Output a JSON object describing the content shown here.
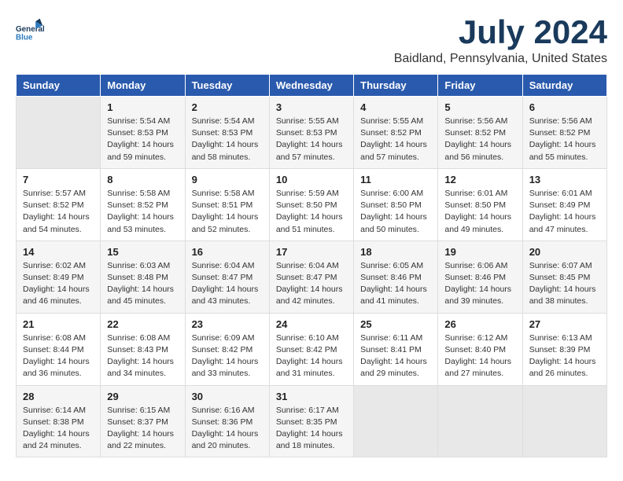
{
  "header": {
    "logo_line1": "General",
    "logo_line2": "Blue",
    "title": "July 2024",
    "subtitle": "Baidland, Pennsylvania, United States"
  },
  "days_of_week": [
    "Sunday",
    "Monday",
    "Tuesday",
    "Wednesday",
    "Thursday",
    "Friday",
    "Saturday"
  ],
  "weeks": [
    [
      {
        "date": "",
        "content": ""
      },
      {
        "date": "1",
        "content": "Sunrise: 5:54 AM\nSunset: 8:53 PM\nDaylight: 14 hours\nand 59 minutes."
      },
      {
        "date": "2",
        "content": "Sunrise: 5:54 AM\nSunset: 8:53 PM\nDaylight: 14 hours\nand 58 minutes."
      },
      {
        "date": "3",
        "content": "Sunrise: 5:55 AM\nSunset: 8:53 PM\nDaylight: 14 hours\nand 57 minutes."
      },
      {
        "date": "4",
        "content": "Sunrise: 5:55 AM\nSunset: 8:52 PM\nDaylight: 14 hours\nand 57 minutes."
      },
      {
        "date": "5",
        "content": "Sunrise: 5:56 AM\nSunset: 8:52 PM\nDaylight: 14 hours\nand 56 minutes."
      },
      {
        "date": "6",
        "content": "Sunrise: 5:56 AM\nSunset: 8:52 PM\nDaylight: 14 hours\nand 55 minutes."
      }
    ],
    [
      {
        "date": "7",
        "content": "Sunrise: 5:57 AM\nSunset: 8:52 PM\nDaylight: 14 hours\nand 54 minutes."
      },
      {
        "date": "8",
        "content": "Sunrise: 5:58 AM\nSunset: 8:52 PM\nDaylight: 14 hours\nand 53 minutes."
      },
      {
        "date": "9",
        "content": "Sunrise: 5:58 AM\nSunset: 8:51 PM\nDaylight: 14 hours\nand 52 minutes."
      },
      {
        "date": "10",
        "content": "Sunrise: 5:59 AM\nSunset: 8:50 PM\nDaylight: 14 hours\nand 51 minutes."
      },
      {
        "date": "11",
        "content": "Sunrise: 6:00 AM\nSunset: 8:50 PM\nDaylight: 14 hours\nand 50 minutes."
      },
      {
        "date": "12",
        "content": "Sunrise: 6:01 AM\nSunset: 8:50 PM\nDaylight: 14 hours\nand 49 minutes."
      },
      {
        "date": "13",
        "content": "Sunrise: 6:01 AM\nSunset: 8:49 PM\nDaylight: 14 hours\nand 47 minutes."
      }
    ],
    [
      {
        "date": "14",
        "content": "Sunrise: 6:02 AM\nSunset: 8:49 PM\nDaylight: 14 hours\nand 46 minutes."
      },
      {
        "date": "15",
        "content": "Sunrise: 6:03 AM\nSunset: 8:48 PM\nDaylight: 14 hours\nand 45 minutes."
      },
      {
        "date": "16",
        "content": "Sunrise: 6:04 AM\nSunset: 8:47 PM\nDaylight: 14 hours\nand 43 minutes."
      },
      {
        "date": "17",
        "content": "Sunrise: 6:04 AM\nSunset: 8:47 PM\nDaylight: 14 hours\nand 42 minutes."
      },
      {
        "date": "18",
        "content": "Sunrise: 6:05 AM\nSunset: 8:46 PM\nDaylight: 14 hours\nand 41 minutes."
      },
      {
        "date": "19",
        "content": "Sunrise: 6:06 AM\nSunset: 8:46 PM\nDaylight: 14 hours\nand 39 minutes."
      },
      {
        "date": "20",
        "content": "Sunrise: 6:07 AM\nSunset: 8:45 PM\nDaylight: 14 hours\nand 38 minutes."
      }
    ],
    [
      {
        "date": "21",
        "content": "Sunrise: 6:08 AM\nSunset: 8:44 PM\nDaylight: 14 hours\nand 36 minutes."
      },
      {
        "date": "22",
        "content": "Sunrise: 6:08 AM\nSunset: 8:43 PM\nDaylight: 14 hours\nand 34 minutes."
      },
      {
        "date": "23",
        "content": "Sunrise: 6:09 AM\nSunset: 8:42 PM\nDaylight: 14 hours\nand 33 minutes."
      },
      {
        "date": "24",
        "content": "Sunrise: 6:10 AM\nSunset: 8:42 PM\nDaylight: 14 hours\nand 31 minutes."
      },
      {
        "date": "25",
        "content": "Sunrise: 6:11 AM\nSunset: 8:41 PM\nDaylight: 14 hours\nand 29 minutes."
      },
      {
        "date": "26",
        "content": "Sunrise: 6:12 AM\nSunset: 8:40 PM\nDaylight: 14 hours\nand 27 minutes."
      },
      {
        "date": "27",
        "content": "Sunrise: 6:13 AM\nSunset: 8:39 PM\nDaylight: 14 hours\nand 26 minutes."
      }
    ],
    [
      {
        "date": "28",
        "content": "Sunrise: 6:14 AM\nSunset: 8:38 PM\nDaylight: 14 hours\nand 24 minutes."
      },
      {
        "date": "29",
        "content": "Sunrise: 6:15 AM\nSunset: 8:37 PM\nDaylight: 14 hours\nand 22 minutes."
      },
      {
        "date": "30",
        "content": "Sunrise: 6:16 AM\nSunset: 8:36 PM\nDaylight: 14 hours\nand 20 minutes."
      },
      {
        "date": "31",
        "content": "Sunrise: 6:17 AM\nSunset: 8:35 PM\nDaylight: 14 hours\nand 18 minutes."
      },
      {
        "date": "",
        "content": ""
      },
      {
        "date": "",
        "content": ""
      },
      {
        "date": "",
        "content": ""
      }
    ]
  ]
}
